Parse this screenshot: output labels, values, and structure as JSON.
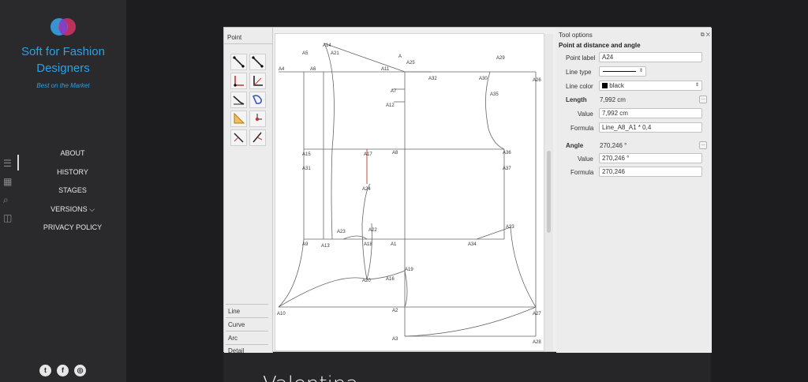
{
  "site": {
    "brand": "Soft for Fashion Designers",
    "tagline": "Best on the Market",
    "nav": [
      {
        "label": "ABOUT"
      },
      {
        "label": "HISTORY"
      },
      {
        "label": "STAGES"
      },
      {
        "label": "VERSIONS"
      },
      {
        "label": "PRIVACY POLICY"
      }
    ],
    "side_icons": [
      "menu-icon",
      "grid-icon",
      "search-icon",
      "book-icon"
    ],
    "socials": [
      "twitter-icon",
      "facebook-icon",
      "instagram-icon"
    ],
    "accent_color": "#2f9fe0"
  },
  "app": {
    "toolbox": {
      "header": "Point",
      "tools": [
        "line-tool",
        "segment-tool",
        "angle-tool",
        "axis-tool",
        "shoulder-tool",
        "curve-tool",
        "triangle-tool",
        "point-tool",
        "normal-tool",
        "bisector-tool"
      ],
      "tabs": [
        "Line",
        "Curve",
        "Arc",
        "Detail"
      ]
    },
    "pattern_points": [
      "A",
      "A1",
      "A2",
      "A3",
      "A4",
      "A5",
      "A6",
      "A7",
      "A8",
      "A9",
      "A10",
      "A11",
      "A12",
      "A13",
      "A14",
      "A15",
      "A16",
      "A17",
      "A18",
      "A19",
      "A20",
      "A21",
      "A22",
      "A23",
      "A24",
      "A25",
      "A26",
      "A27",
      "A28",
      "A29",
      "A30",
      "A31",
      "A32",
      "A33",
      "A34",
      "A35",
      "A36",
      "A37"
    ],
    "tool_options": {
      "title": "Tool options",
      "subtitle": "Point at distance and angle",
      "point_label": {
        "label": "Point label",
        "value": "A24"
      },
      "line_type": {
        "label": "Line type"
      },
      "line_color": {
        "label": "Line color",
        "value": "black"
      },
      "length": {
        "label": "Length",
        "display": "7,992 cm",
        "value_label": "Value",
        "value": "7,992 cm",
        "formula_label": "Formula",
        "formula": "Line_A8_A1 * 0,4"
      },
      "angle": {
        "label": "Angle",
        "display": "270,246 °",
        "value_label": "Value",
        "value": "270,246 °",
        "formula_label": "Formula",
        "formula": "270,246"
      }
    }
  },
  "card": {
    "title": "Valentina"
  }
}
